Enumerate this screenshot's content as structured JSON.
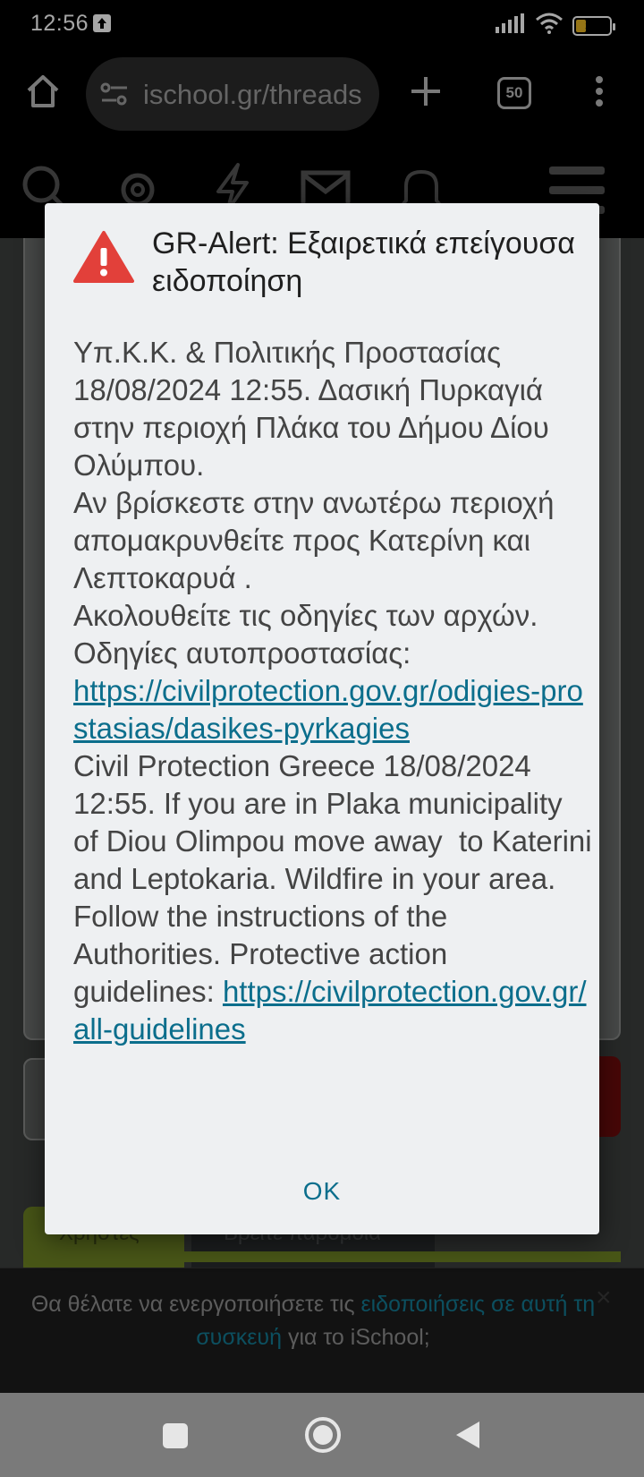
{
  "status_bar": {
    "time": "12:56",
    "battery_level": 31,
    "battery_label": "31"
  },
  "browser": {
    "url": "ischool.gr/threads",
    "tab_count": "50"
  },
  "site_nav": {
    "icons": [
      "search-icon",
      "gear-icon",
      "lightning-icon",
      "mail-icon",
      "bell-icon",
      "menu-icon"
    ]
  },
  "background_page": {
    "tab_users": "Χρήστες",
    "tab_find_doctor": "Βρείτε παρόμοια"
  },
  "alert_dialog": {
    "title": "GR-Alert: Εξαιρετικά επείγουσα ειδοποίηση",
    "body_greek": "Υπ.Κ.Κ. & Πολιτικής Προστασίας 18/08/2024 12:55. Δασική Πυρκαγιά στην περιοχή Πλάκα του Δήμου Δίου Ολύμπου.\nΑν βρίσκεστε στην ανωτέρω περιοχή απομακρυνθείτε προς Κατερίνη και Λεπτοκαρυά .\nΑκολουθείτε τις οδηγίες των αρχών. Οδηγίες αυτοπροστασίας:",
    "link_greek": "https://civilprotection.gov.gr/odigies-prostasias/dasikes-pyrkagies",
    "body_english": "Civil Protection Greece 18/08/2024 12:55. If you are in Plaka municipality of Diou Olimpou move away  to Katerini and Leptokaria. Wildfire in your area. Follow the instructions of the Authorities. Protective action guidelines:",
    "link_english": "https://civilprotection.gov.gr/all-guidelines",
    "ok_label": "OK"
  },
  "notification_banner": {
    "text_before": "Θα θέλατε να ενεργοποιήσετε τις ",
    "link_text": "ειδοποιήσεις σε αυτή τη συσκευή",
    "text_after": " για το iSchool;",
    "close_label": "×"
  },
  "colors": {
    "accent_link": "#0b6e8c",
    "alert_red": "#e2403a",
    "battery": "#e6b422"
  }
}
